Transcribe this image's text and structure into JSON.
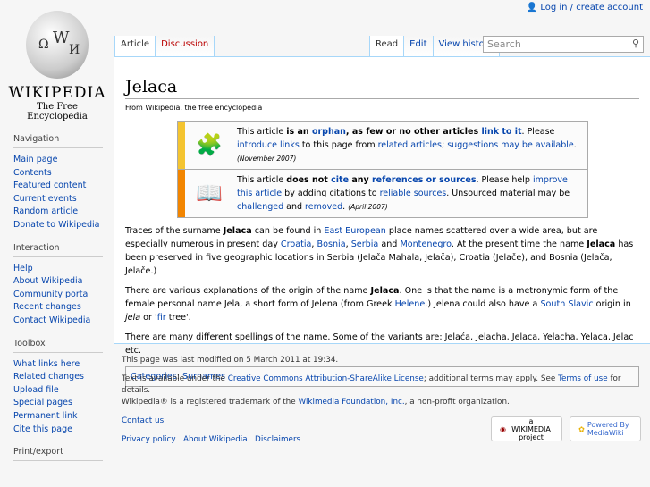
{
  "logo": {
    "wordmark": "Wikipedia",
    "tagline": "The Free Encyclopedia",
    "glyphs": [
      "Ω",
      "W",
      "И"
    ]
  },
  "personal": {
    "login": "Log in / create account"
  },
  "tabs_left": [
    "Article",
    "Discussion"
  ],
  "tabs_right": [
    "Read",
    "Edit",
    "View history"
  ],
  "search": {
    "placeholder": "Search"
  },
  "article": {
    "title": "Jelaca",
    "subtitle": "From Wikipedia, the free encyclopedia",
    "box1": {
      "a": "This article ",
      "b": "is an ",
      "c": "orphan",
      "d": ", as few or no other articles ",
      "e": "link to it",
      "f": ". Please ",
      "g": "introduce links",
      "h": " to this page from ",
      "i": "related articles",
      "j": "; ",
      "k": "suggestions may be available",
      "l": ". ",
      "date": "(November 2007)"
    },
    "box2": {
      "a": "This article ",
      "b": "does not ",
      "c": "cite",
      "d": " any ",
      "e": "references or sources",
      "f": ". Please help ",
      "g": "improve this article",
      "h": " by adding citations to ",
      "i": "reliable sources",
      "j": ". Unsourced material may be ",
      "k": "challenged",
      "l": " and ",
      "m": "removed",
      "n": ". ",
      "date": "(April 2007)"
    },
    "p1": {
      "a": "Traces of the surname ",
      "b": "Jelaca",
      "c": " can be found in ",
      "d": "East European",
      "e": " place names scattered over a wide area, but are especially numerous in present day ",
      "f": "Croatia",
      "g": ", ",
      "h": "Bosnia",
      "i": ", ",
      "j": "Serbia",
      "k": " and ",
      "l": "Montenegro",
      "m": ". At the present time the name ",
      "n": "Jelaca",
      "o": " has been preserved in five geographic locations in Serbia (Jelača Mahala, Jelača), Croatia (Jelače), and Bosnia (Jelača, Jelače.)"
    },
    "p2": {
      "a": "There are various explanations of the origin of the name ",
      "b": "Jelaca",
      "c": ". One is that the name is a metronymic form of the female personal name Jela, a short form of Jelena (from Greek ",
      "d": "Helene",
      "e": ".) Jelena could also have a ",
      "f": "South Slavic",
      "g": " origin in ",
      "h": "jela",
      "i": " or '",
      "j": "fir",
      "k": " tree'."
    },
    "p3": "There are many different spellings of the name. Some of the variants are: Jelaća, Jelacha, Jelaca, Yelacha, Yelaca, Jelac etc.",
    "categories": {
      "label": "Categories",
      "sep": ": ",
      "items": [
        "Surnames"
      ]
    }
  },
  "sidebar": [
    {
      "title": "Navigation",
      "items": [
        "Main page",
        "Contents",
        "Featured content",
        "Current events",
        "Random article",
        "Donate to Wikipedia"
      ]
    },
    {
      "title": "Interaction",
      "items": [
        "Help",
        "About Wikipedia",
        "Community portal",
        "Recent changes",
        "Contact Wikipedia"
      ]
    },
    {
      "title": "Toolbox",
      "items": [
        "What links here",
        "Related changes",
        "Upload file",
        "Special pages",
        "Permanent link",
        "Cite this page"
      ]
    },
    {
      "title": "Print/export",
      "items": []
    }
  ],
  "footer": {
    "modified": "This page was last modified on 5 March 2011 at 19:34.",
    "lic_a": "Text is available under the ",
    "lic_b": "Creative Commons Attribution-ShareAlike License",
    "lic_c": "; additional terms may apply. See ",
    "lic_d": "Terms of use",
    "lic_e": " for details.",
    "tm_a": "Wikipedia® is a registered trademark of the ",
    "tm_b": "Wikimedia Foundation, Inc.",
    "tm_c": ", a non-profit organization.",
    "contact": "Contact us",
    "links": [
      "Privacy policy",
      "About Wikipedia",
      "Disclaimers"
    ],
    "badge1": "a WIKIMEDIA project",
    "badge2": "Powered By MediaWiki"
  }
}
